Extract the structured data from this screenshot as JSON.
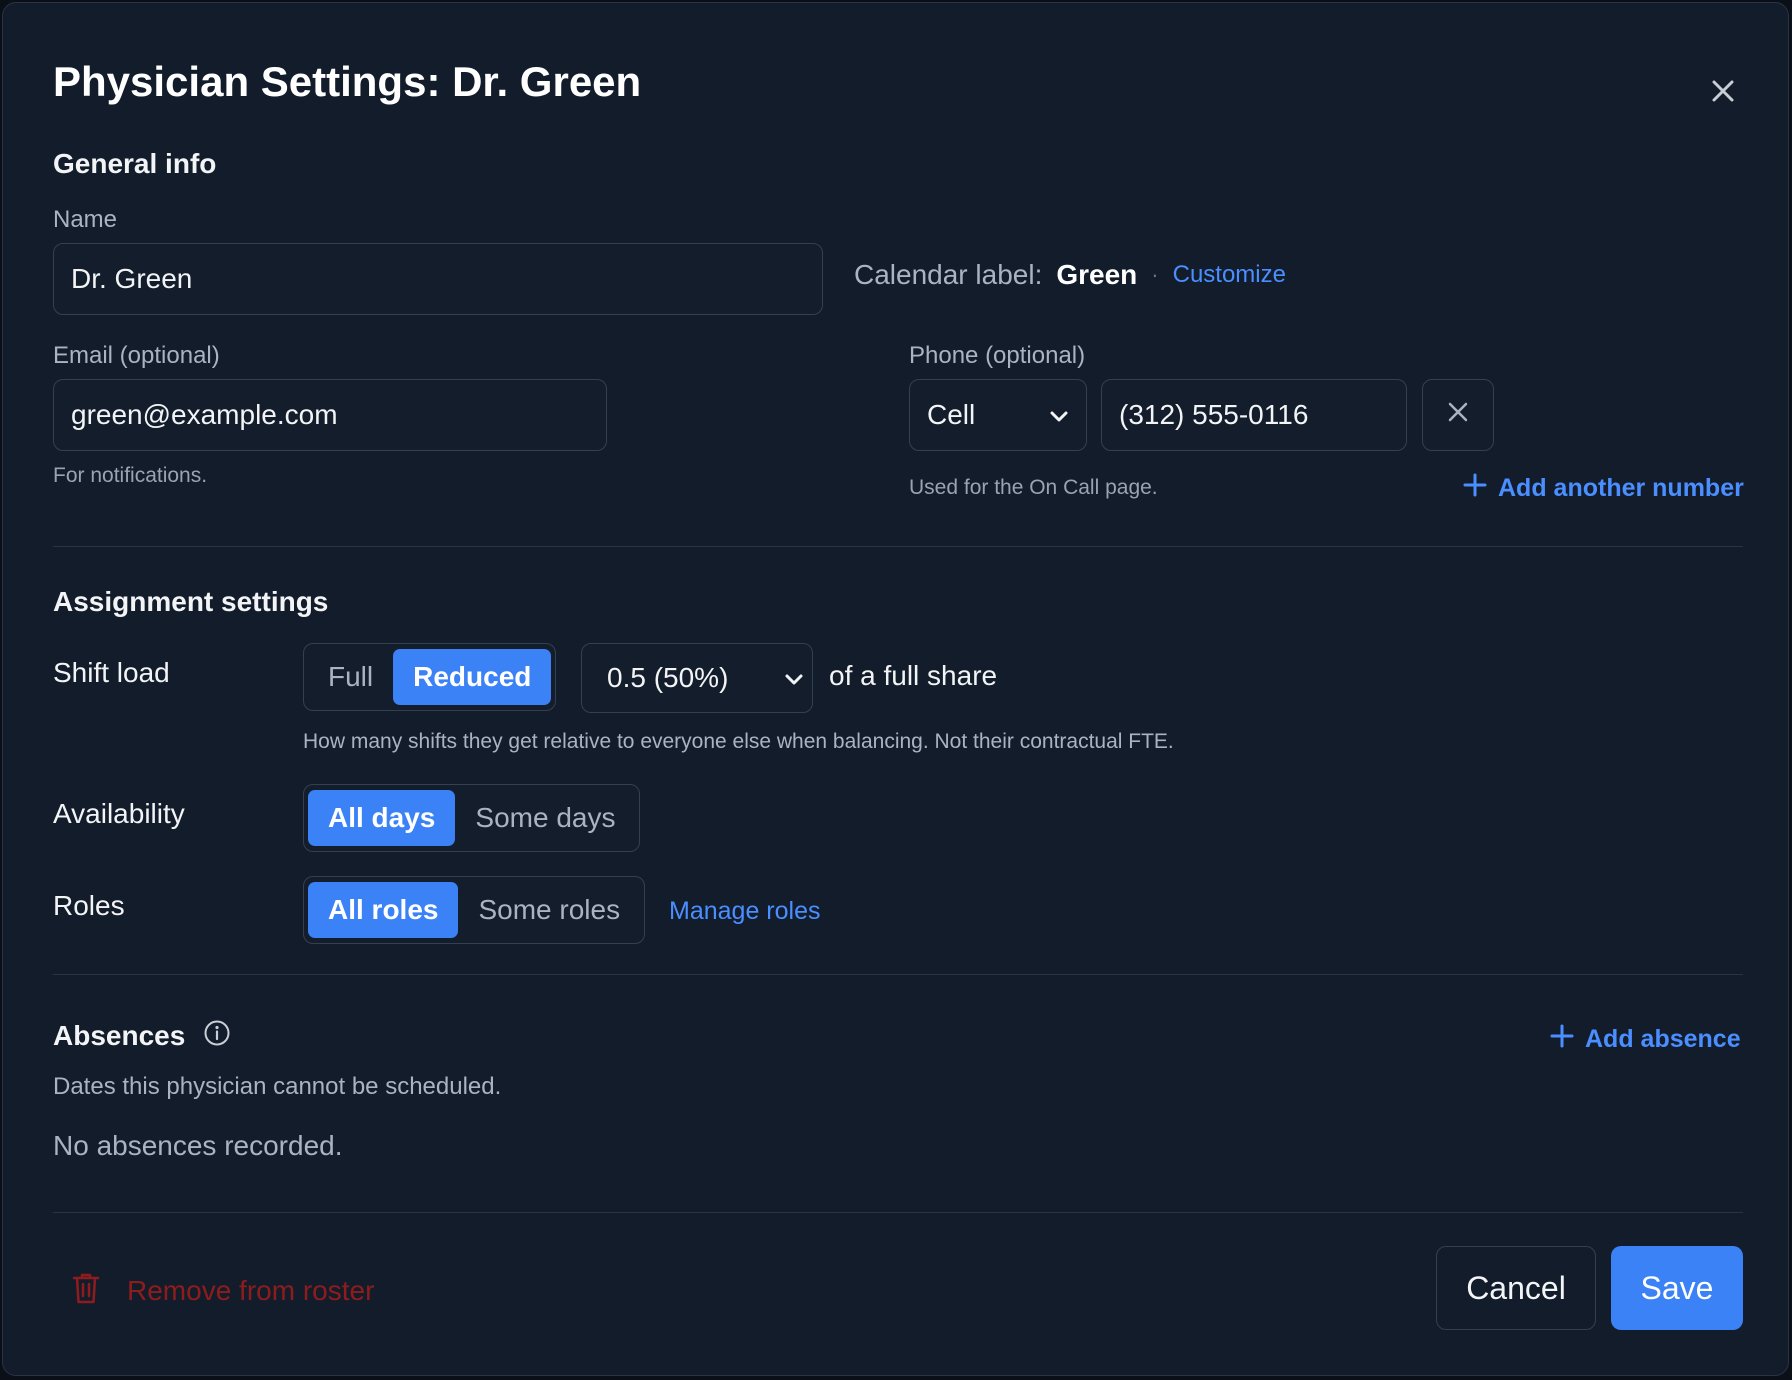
{
  "dialog": {
    "title": "Physician Settings: Dr. Green"
  },
  "general_info": {
    "heading": "General info",
    "name_label": "Name",
    "name_value": "Dr. Green",
    "calendar_label_prefix": "Calendar label:",
    "calendar_label_value": "Green",
    "separator": "·",
    "customize_link": "Customize",
    "email_label": "Email (optional)",
    "email_value": "green@example.com",
    "email_help": "For notifications.",
    "phone_label": "Phone (optional)",
    "phone_type": "Cell",
    "phone_value": "(312) 555-0116",
    "phone_help": "Used for the On Call page.",
    "add_number_label": "Add another number"
  },
  "assignment": {
    "heading": "Assignment settings",
    "shift_load_label": "Shift load",
    "shift_load_options": [
      "Full",
      "Reduced"
    ],
    "shift_load_selected": "Reduced",
    "share_value": "0.5 (50%)",
    "share_suffix": "of a full share",
    "shift_load_help": "How many shifts they get relative to everyone else when balancing. Not their contractual FTE.",
    "availability_label": "Availability",
    "availability_options": [
      "All days",
      "Some days"
    ],
    "availability_selected": "All days",
    "roles_label": "Roles",
    "roles_options": [
      "All roles",
      "Some roles"
    ],
    "roles_selected": "All roles",
    "manage_roles_link": "Manage roles"
  },
  "absences": {
    "heading": "Absences",
    "add_absence_label": "Add absence",
    "description": "Dates this physician cannot be scheduled.",
    "empty_text": "No absences recorded."
  },
  "footer": {
    "remove_label": "Remove from roster",
    "cancel_label": "Cancel",
    "save_label": "Save"
  },
  "colors": {
    "background": "#121c2b",
    "accent": "#3b82f6",
    "link": "#4a8eff",
    "danger": "#8f1c1c"
  },
  "icons": {
    "close": "close-icon",
    "phone_remove": "clear-icon",
    "add": "plus-icon",
    "info": "info-icon",
    "trash": "trash-icon",
    "dropdown": "chevron-down-icon"
  }
}
